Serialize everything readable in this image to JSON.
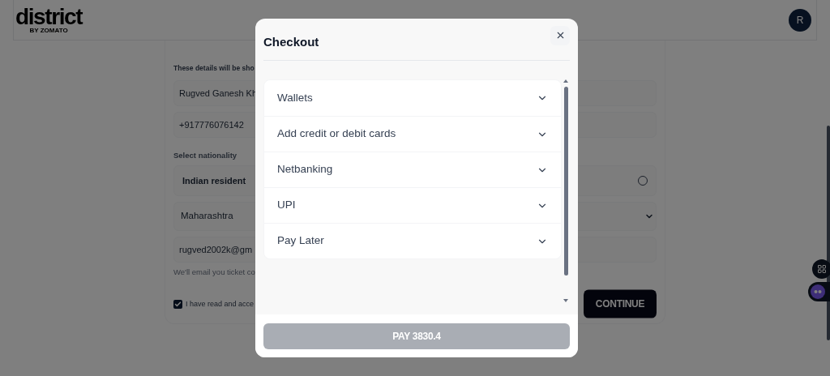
{
  "header": {
    "logo": "district",
    "logo_tagline": "BY ZOMATO",
    "avatar": "R"
  },
  "form": {
    "note": "These details will be sho",
    "fields": [
      {
        "kind": "input",
        "value": "Rugved Ganesh Kh"
      },
      {
        "kind": "input",
        "value": "+917776076142"
      },
      {
        "kind": "label",
        "text": "Select nationality"
      },
      {
        "kind": "radio",
        "label": "Indian resident",
        "selected": false
      },
      {
        "kind": "select",
        "value": "Maharashtra"
      },
      {
        "kind": "input",
        "value": "rugved2002k@gm"
      },
      {
        "kind": "hint",
        "text": "We'll email you ticket co"
      }
    ],
    "terms": {
      "label": "I have read and acce",
      "checked": true
    },
    "continue": "CONTINUE"
  },
  "modal": {
    "title": "Checkout",
    "options": [
      {
        "label": "Wallets",
        "expanded": false
      },
      {
        "label": "Add credit or debit cards",
        "expanded": false
      },
      {
        "label": "Netbanking",
        "expanded": false
      },
      {
        "label": "UPI",
        "expanded": false
      },
      {
        "label": "Pay Later",
        "expanded": false
      }
    ],
    "pay": "PAY 3830.4",
    "pay_disabled": true
  }
}
